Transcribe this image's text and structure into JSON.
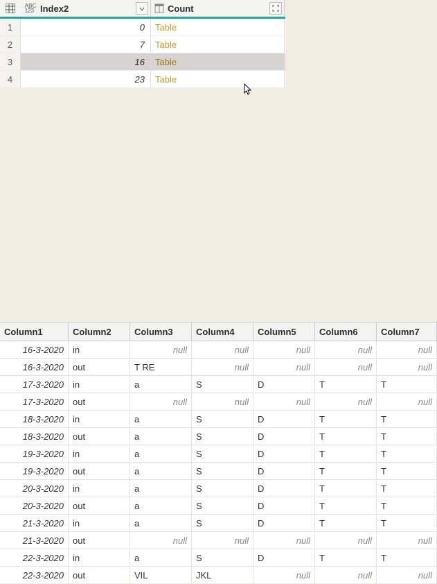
{
  "upper": {
    "columns": {
      "index2": "Index2",
      "count": "Count"
    },
    "rows": [
      {
        "num": "1",
        "index2": "0",
        "count": "Table",
        "selected": false
      },
      {
        "num": "2",
        "index2": "7",
        "count": "Table",
        "selected": false
      },
      {
        "num": "3",
        "index2": "16",
        "count": "Table",
        "selected": true
      },
      {
        "num": "4",
        "index2": "23",
        "count": "Table",
        "selected": false
      }
    ]
  },
  "null_label": "null",
  "lower": {
    "columns": [
      "Column1",
      "Column2",
      "Column3",
      "Column4",
      "Column5",
      "Column6",
      "Column7"
    ],
    "rows": [
      {
        "c1": "16-3-2020",
        "c2": "in",
        "c3": null,
        "c4": null,
        "c5": null,
        "c6": null,
        "c7": null
      },
      {
        "c1": "16-3-2020",
        "c2": "out",
        "c3": "T RE",
        "c4": null,
        "c5": null,
        "c6": null,
        "c7": null
      },
      {
        "c1": "17-3-2020",
        "c2": "in",
        "c3": "a",
        "c4": "S",
        "c5": "D",
        "c6": "T",
        "c7": "T"
      },
      {
        "c1": "17-3-2020",
        "c2": "out",
        "c3": null,
        "c4": null,
        "c5": null,
        "c6": null,
        "c7": null
      },
      {
        "c1": "18-3-2020",
        "c2": "in",
        "c3": "a",
        "c4": "S",
        "c5": "D",
        "c6": "T",
        "c7": "T"
      },
      {
        "c1": "18-3-2020",
        "c2": "out",
        "c3": "a",
        "c4": "S",
        "c5": "D",
        "c6": "T",
        "c7": "T"
      },
      {
        "c1": "19-3-2020",
        "c2": "in",
        "c3": "a",
        "c4": "S",
        "c5": "D",
        "c6": "T",
        "c7": "T"
      },
      {
        "c1": "19-3-2020",
        "c2": "out",
        "c3": "a",
        "c4": "S",
        "c5": "D",
        "c6": "T",
        "c7": "T"
      },
      {
        "c1": "20-3-2020",
        "c2": "in",
        "c3": "a",
        "c4": "S",
        "c5": "D",
        "c6": "T",
        "c7": "T"
      },
      {
        "c1": "20-3-2020",
        "c2": "out",
        "c3": "a",
        "c4": "S",
        "c5": "D",
        "c6": "T",
        "c7": "T"
      },
      {
        "c1": "21-3-2020",
        "c2": "in",
        "c3": "a",
        "c4": "S",
        "c5": "D",
        "c6": "T",
        "c7": "T"
      },
      {
        "c1": "21-3-2020",
        "c2": "out",
        "c3": null,
        "c4": null,
        "c5": null,
        "c6": null,
        "c7": null
      },
      {
        "c1": "22-3-2020",
        "c2": "in",
        "c3": "a",
        "c4": "S",
        "c5": "D",
        "c6": "T",
        "c7": "T"
      },
      {
        "c1": "22-3-2020",
        "c2": "out",
        "c3": "VIL",
        "c4": "JKL",
        "c5": null,
        "c6": null,
        "c7": null
      }
    ]
  }
}
